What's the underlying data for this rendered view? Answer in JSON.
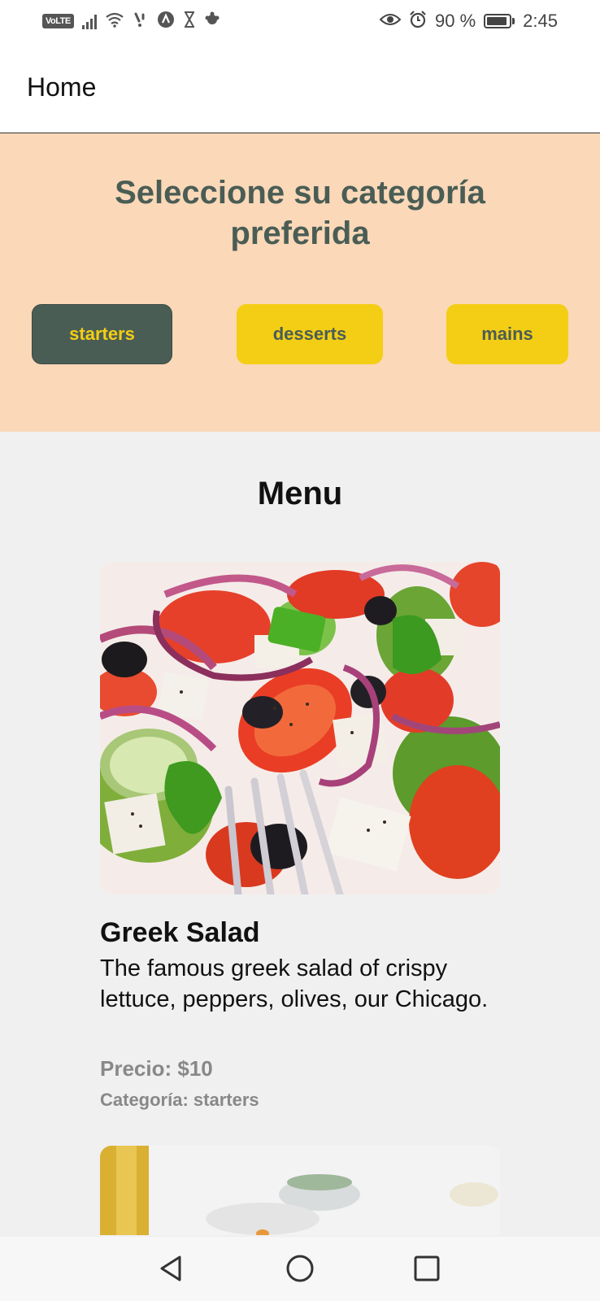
{
  "status_bar": {
    "volte": "VoLTE",
    "battery_text": "90 %",
    "battery_level": 0.9,
    "time": "2:45",
    "icons": [
      "signal-icon",
      "wifi-icon",
      "notification-icon",
      "app-icon",
      "hourglass-icon",
      "settings-icon",
      "eye-icon",
      "alarm-icon",
      "battery-icon"
    ]
  },
  "app_bar": {
    "title": "Home"
  },
  "category": {
    "heading": "Seleccione su categoría preferida",
    "buttons": [
      {
        "label": "starters",
        "active": true
      },
      {
        "label": "desserts",
        "active": false
      },
      {
        "label": "mains",
        "active": false
      }
    ]
  },
  "menu": {
    "title": "Menu",
    "items": [
      {
        "name": "Greek Salad",
        "description": "The famous greek salad of crispy lettuce, peppers, olives, our Chicago.",
        "price": "Precio: $10",
        "category": "Categoría: starters"
      }
    ]
  },
  "nav_bar": {
    "icons": [
      "back-icon",
      "home-icon",
      "recents-icon"
    ]
  },
  "colors": {
    "primary": "#4a5d55",
    "accent": "#f4ce14",
    "panel": "#fad8b8"
  }
}
